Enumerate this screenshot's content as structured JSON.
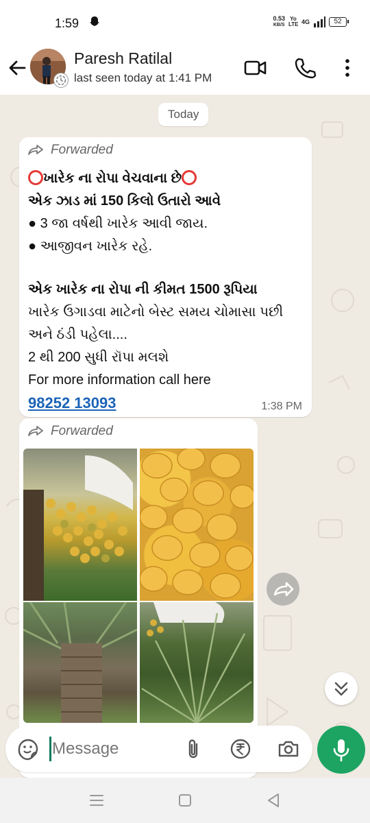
{
  "status_bar": {
    "time": "1:59",
    "net_speed_value": "0.53",
    "net_speed_unit": "KB/S",
    "volte": "Yo LTE",
    "network": "4G",
    "battery": "52"
  },
  "header": {
    "contact_name": "Paresh Ratilal",
    "last_seen": "last seen today at 1:41 PM"
  },
  "chat": {
    "date_chip": "Today",
    "messages": [
      {
        "forwarded_label": "Forwarded",
        "line1": "ખારેક ના રોપા વેચવાના છે",
        "line2": "એક ઝાડ માં 150 કિલો ઉતારો આવે",
        "line3": "● 3 જા વર્ષથી ખારેક આવી જાય.",
        "line4": "● આજીવન ખારેક રહે.",
        "line5": "એક ખારેક ના રોપા ની કીમત 1500 રૂપિયા",
        "line6": "ખારેક ઉગાડવા માટેનો બેસ્ટ સમય ચોમાસા પછી",
        "line7": "અને ઠંડી પહેલા....",
        "line8": "2  થી 200 સુધી રૉપા મલશે",
        "line9": "For more information call here",
        "phone": "98252 13093",
        "time": "1:38 PM"
      },
      {
        "forwarded_label": "Forwarded",
        "images": [
          "date-palm-fruit-bunch",
          "yellow-dates-closeup",
          "date-palm-trunk",
          "date-palm-tree"
        ]
      }
    ]
  },
  "input": {
    "placeholder": "Message"
  },
  "colors": {
    "accent_green": "#1da462",
    "chat_background": "#efeae2",
    "link_blue": "#1b64b8",
    "emoji_ring_red": "#e53935"
  }
}
